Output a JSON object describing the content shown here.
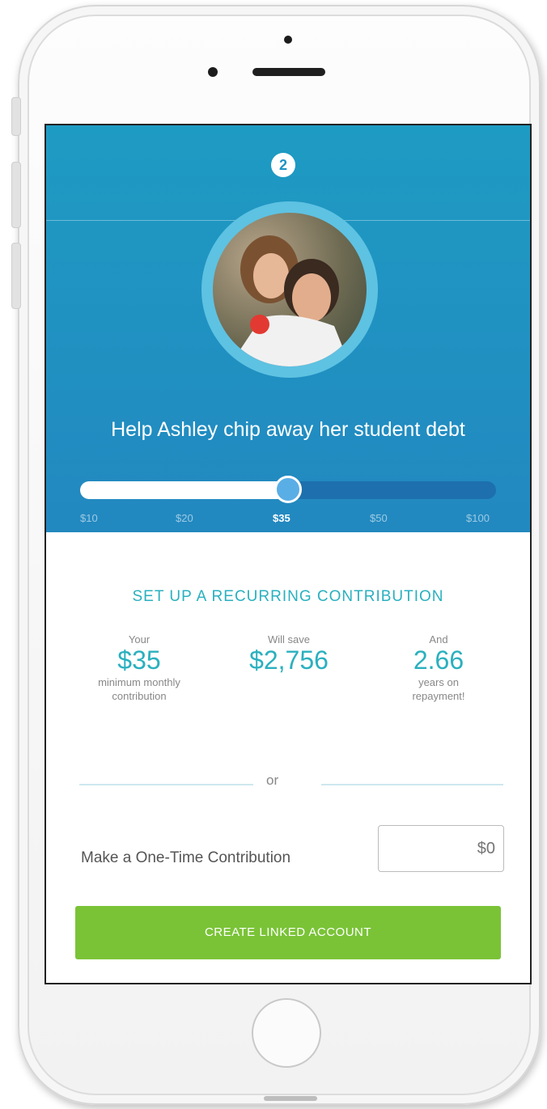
{
  "header": {
    "logo_glyph": "2",
    "title": "Help Ashley chip away her student debt"
  },
  "slider": {
    "ticks": [
      "$10",
      "$20",
      "$35",
      "$50",
      "$100"
    ],
    "selected": "$35",
    "fill_fraction": 0.5
  },
  "recurring": {
    "title": "SET UP A RECURRING CONTRIBUTION",
    "stat1": {
      "label": "Your",
      "value": "$35",
      "sub1": "minimum monthly",
      "sub2": "contribution"
    },
    "stat2": {
      "label": "Will save",
      "value": "$2,756"
    },
    "stat3": {
      "label": "And",
      "value": "2.66",
      "sub1": "years on",
      "sub2": "repayment!"
    }
  },
  "divider": {
    "text": "or"
  },
  "one_time": {
    "label": "Make a One-Time Contribution",
    "placeholder": "$0"
  },
  "cta": {
    "label": "CREATE LINKED ACCOUNT"
  },
  "colors": {
    "header_top": "#1e9bc3",
    "header_bottom": "#2288c0",
    "accent_teal": "#2ab0bf",
    "cta_green": "#7ac337"
  }
}
